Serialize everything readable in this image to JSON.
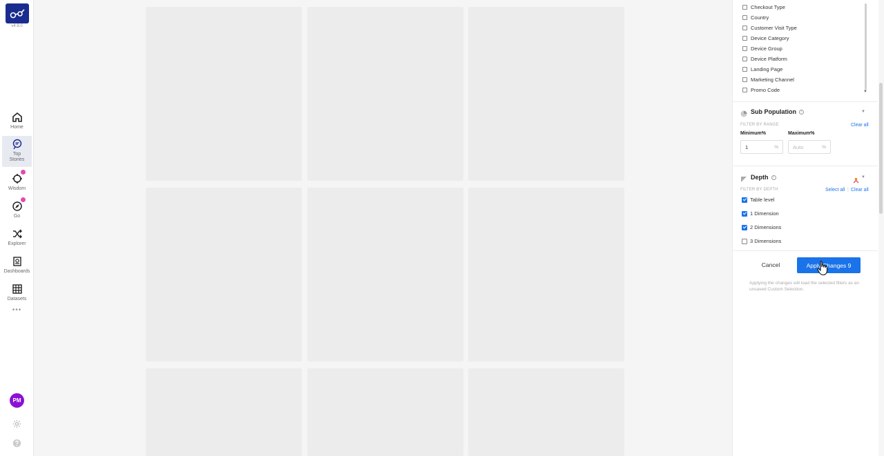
{
  "app": {
    "version": "v4.9.0",
    "brand_color": "#1a2d8f"
  },
  "nav": {
    "items": [
      {
        "label": "Home",
        "icon": "home-icon"
      },
      {
        "label": "Top\nStories",
        "icon": "top-stories-icon",
        "active": true
      },
      {
        "label": "Wisdom",
        "icon": "wisdom-icon",
        "badge": true
      },
      {
        "label": "Go",
        "icon": "go-icon",
        "badge": true
      },
      {
        "label": "Explorer",
        "icon": "shuffle-icon"
      },
      {
        "label": "Dashboards",
        "icon": "dashboard-icon"
      },
      {
        "label": "Datasets",
        "icon": "table-icon"
      }
    ],
    "more": "•••",
    "user_initials": "PM",
    "avatar_color": "#8a11d6"
  },
  "filters": {
    "dimensions": [
      {
        "label": "Checkout Type",
        "checked": false
      },
      {
        "label": "Country",
        "checked": false
      },
      {
        "label": "Customer Visit Type",
        "checked": false
      },
      {
        "label": "Device Category",
        "checked": false
      },
      {
        "label": "Device Group",
        "checked": false
      },
      {
        "label": "Device Platform",
        "checked": false
      },
      {
        "label": "Landing Page",
        "checked": false
      },
      {
        "label": "Marketing Channel",
        "checked": false
      },
      {
        "label": "Promo Code",
        "checked": false
      }
    ],
    "sub_population": {
      "title": "Sub Population",
      "filter_label": "FILTER BY RANGE",
      "clear_all": "Clear all",
      "min_label": "Minimum%",
      "max_label": "Maximum%",
      "min_value": "1",
      "max_placeholder": "Auto",
      "unit": "%"
    },
    "depth": {
      "title": "Depth",
      "filter_label": "FILTER BY DEPTH",
      "select_all": "Select all",
      "separator": "|",
      "clear_all": "Clear all",
      "options": [
        {
          "label": "Table level",
          "checked": true
        },
        {
          "label": "1 Dimension",
          "checked": true
        },
        {
          "label": "2 Dimensions",
          "checked": true
        },
        {
          "label": "3 Dimensions",
          "checked": false
        }
      ]
    },
    "actions": {
      "cancel": "Cancel",
      "apply": "Apply Changes 9",
      "note": "Applying the changes will load the selected filters as an unsaved Custom Selection.",
      "accent": "#1a73e8"
    }
  }
}
